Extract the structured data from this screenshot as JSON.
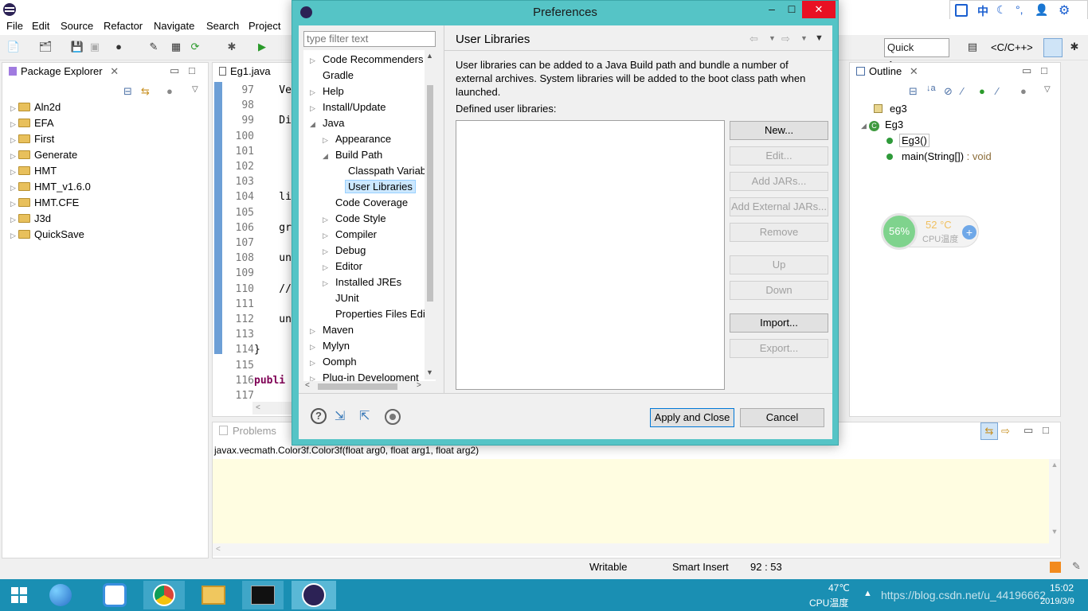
{
  "window": {
    "menu": [
      "File",
      "Edit",
      "Source",
      "Refactor",
      "Navigate",
      "Search",
      "Project"
    ],
    "quick_access": "Quick Access",
    "perspective": "<C/C++>"
  },
  "package_explorer": {
    "title": "Package Explorer",
    "projects": [
      "Aln2d",
      "EFA",
      "First",
      "Generate",
      "HMT",
      "HMT_v1.6.0",
      "HMT.CFE",
      "J3d",
      "QuickSave"
    ]
  },
  "editor": {
    "tab": "Eg1.java",
    "lines": [
      {
        "num": "97",
        "code": "    Vec"
      },
      {
        "num": "98",
        "code": ""
      },
      {
        "num": "99",
        "code": "    Dir"
      },
      {
        "num": "100",
        "code": ""
      },
      {
        "num": "101",
        "code": ""
      },
      {
        "num": "102",
        "code": ""
      },
      {
        "num": "103",
        "code": ""
      },
      {
        "num": "104",
        "code": "    lig"
      },
      {
        "num": "105",
        "code": ""
      },
      {
        "num": "106",
        "code": "    gro"
      },
      {
        "num": "107",
        "code": ""
      },
      {
        "num": "108",
        "code": "    uni"
      },
      {
        "num": "109",
        "code": ""
      },
      {
        "num": "110",
        "code": "    //"
      },
      {
        "num": "111",
        "code": ""
      },
      {
        "num": "112",
        "code": "    uni"
      },
      {
        "num": "113",
        "code": ""
      },
      {
        "num": "114",
        "code": "}"
      },
      {
        "num": "115",
        "code": ""
      },
      {
        "num": "116",
        "code": "publi"
      },
      {
        "num": "117",
        "code": ""
      }
    ]
  },
  "outline": {
    "title": "Outline",
    "items": [
      {
        "label": "eg3",
        "type": ""
      },
      {
        "label": "Eg3",
        "type": ""
      },
      {
        "label": "Eg3()",
        "type": ""
      },
      {
        "label": "main(String[])",
        "type": " : void"
      }
    ]
  },
  "cpu_widget": {
    "percent": "56%",
    "temp": "52 °C",
    "label": "CPU温度"
  },
  "problems": {
    "tab": "Problems",
    "text": "javax.vecmath.Color3f.Color3f(float arg0, float arg1, float arg2)"
  },
  "statusbar": {
    "writable": "Writable",
    "insert": "Smart Insert",
    "position": "92 : 53"
  },
  "dialog": {
    "title": "Preferences",
    "filter_placeholder": "type filter text",
    "tree": [
      {
        "label": "Code Recommenders",
        "level": 0,
        "twisty": "▷"
      },
      {
        "label": "Gradle",
        "level": 0,
        "twisty": ""
      },
      {
        "label": "Help",
        "level": 0,
        "twisty": "▷"
      },
      {
        "label": "Install/Update",
        "level": 0,
        "twisty": "▷"
      },
      {
        "label": "Java",
        "level": 0,
        "twisty": "◢"
      },
      {
        "label": "Appearance",
        "level": 1,
        "twisty": "▷"
      },
      {
        "label": "Build Path",
        "level": 1,
        "twisty": "◢"
      },
      {
        "label": "Classpath Variab",
        "level": 2,
        "twisty": ""
      },
      {
        "label": "User Libraries",
        "level": 2,
        "twisty": "",
        "selected": true
      },
      {
        "label": "Code Coverage",
        "level": 1,
        "twisty": ""
      },
      {
        "label": "Code Style",
        "level": 1,
        "twisty": "▷"
      },
      {
        "label": "Compiler",
        "level": 1,
        "twisty": "▷"
      },
      {
        "label": "Debug",
        "level": 1,
        "twisty": "▷"
      },
      {
        "label": "Editor",
        "level": 1,
        "twisty": "▷"
      },
      {
        "label": "Installed JREs",
        "level": 1,
        "twisty": "▷"
      },
      {
        "label": "JUnit",
        "level": 1,
        "twisty": ""
      },
      {
        "label": "Properties Files Edi",
        "level": 1,
        "twisty": ""
      },
      {
        "label": "Maven",
        "level": 0,
        "twisty": "▷"
      },
      {
        "label": "Mylyn",
        "level": 0,
        "twisty": "▷"
      },
      {
        "label": "Oomph",
        "level": 0,
        "twisty": "▷"
      },
      {
        "label": "Plug-in Development",
        "level": 0,
        "twisty": "▷"
      }
    ],
    "page_title": "User Libraries",
    "description": "User libraries can be added to a Java Build path and bundle a number of external archives. System libraries will be added to the boot class path when launched.",
    "defined_label": "Defined user libraries:",
    "buttons": {
      "new": "New...",
      "edit": "Edit...",
      "add_jars": "Add JARs...",
      "add_external_jars": "Add External JARs...",
      "remove": "Remove",
      "up": "Up",
      "down": "Down",
      "import": "Import...",
      "export": "Export..."
    },
    "apply_close": "Apply and Close",
    "cancel": "Cancel"
  },
  "taskbar": {
    "temp": "47℃",
    "temp_label": "CPU温度",
    "time": "15:02",
    "date": "2019/3/9",
    "watermark": "https://blog.csdn.net/u_44196662"
  },
  "colors": {
    "dialog_frame": "#55c4c6",
    "taskbar": "#1a8fb3",
    "close_red": "#e81123",
    "selection": "#cce8ff"
  }
}
